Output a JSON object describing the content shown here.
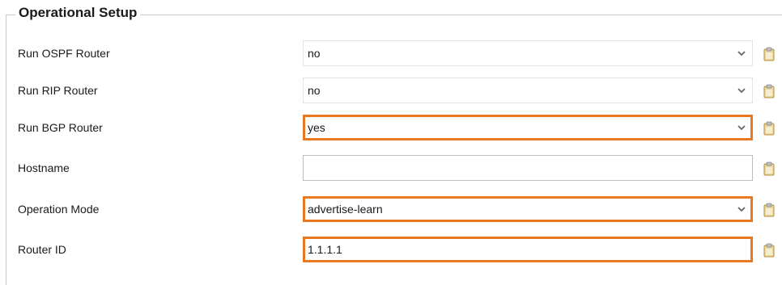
{
  "section": {
    "title": "Operational Setup"
  },
  "rows": [
    {
      "label": "Run OSPF Router",
      "value": "no",
      "type": "select",
      "highlighted": false
    },
    {
      "label": "Run RIP Router",
      "value": "no",
      "type": "select",
      "highlighted": false
    },
    {
      "label": "Run BGP Router",
      "value": "yes",
      "type": "select",
      "highlighted": true
    },
    {
      "label": "Hostname",
      "value": "",
      "type": "input",
      "highlighted": false
    },
    {
      "label": "Operation Mode",
      "value": "advertise-learn",
      "type": "select",
      "highlighted": true
    },
    {
      "label": "Router ID",
      "value": "1.1.1.1",
      "type": "input",
      "highlighted": true
    }
  ],
  "colors": {
    "highlight": "#e8781f",
    "clipboard_icon": "#c9a24a"
  },
  "icons": {
    "dropdown": "chevron-down-icon",
    "trailing": "clipboard-icon"
  }
}
